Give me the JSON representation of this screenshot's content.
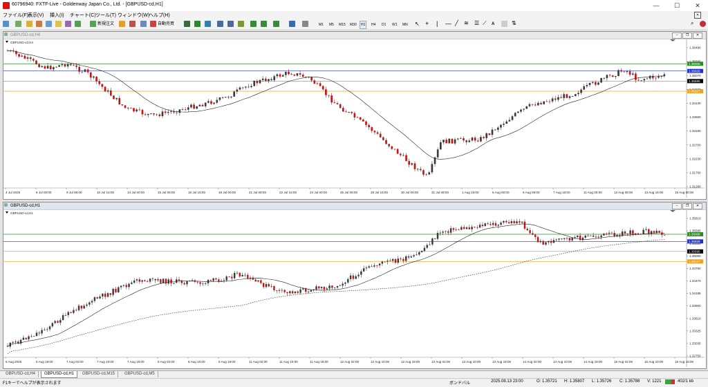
{
  "window": {
    "title": "60796940: FXTF-Live - Goldenway Japan Co., Ltd. - [GBPUSD-cd,H1]"
  },
  "menu": [
    "ファイル(F)",
    "表示(V)",
    "挿入(I)",
    "チャート(C)",
    "ツール(T)",
    "ウィンドウ(W)",
    "ヘルプ(H)"
  ],
  "toolbar": {
    "new_order": "新規注文",
    "auto_trade": "自動売買",
    "timeframes": [
      "M1",
      "M5",
      "M15",
      "M30",
      "H1",
      "H4",
      "D1",
      "W1",
      "MN"
    ],
    "active_timeframe": "H1",
    "letter_a": "A"
  },
  "chart_h4": {
    "window_title": "GBPUSD-cd,H4",
    "label": "GBPUSD-cd,H4",
    "price_ticks": [
      "1.36490",
      "1.35595",
      "1.35070",
      "1.34600",
      "1.34130",
      "1.33650",
      "1.33180",
      "1.32700",
      "1.32230",
      "1.31760",
      "1.31280"
    ],
    "price_tags": [
      {
        "text": "1.36006",
        "color": "#2e8b2e"
      },
      {
        "text": "1.35826",
        "color": "#2233cc"
      },
      {
        "text": "1.35595",
        "color": "#000000"
      },
      {
        "text": "1.35127",
        "color": "#f0a020"
      }
    ],
    "time_labels": [
      "4 Jul 2025",
      "8 Jul 00:00",
      "9 Jul 08:00",
      "10 Jul 16:00",
      "14 Jul 00:00",
      "15 Jul 08:00",
      "16 Jul 16:00",
      "18 Jul 00:00",
      "21 Jul 08:00",
      "22 Jul 16:00",
      "24 Jul 00:00",
      "25 Jul 08:00",
      "28 Jul 16:00",
      "30 Jul 00:00",
      "31 Jul 08:00",
      "1 Aug 16:00",
      "5 Aug 00:00",
      "6 Aug 08:00",
      "7 Aug 16:00",
      "11 Aug 00:00",
      "12 Aug 08:00",
      "13 Aug 16:00",
      "15 Aug 00:00"
    ]
  },
  "chart_h1": {
    "window_title": "GBPUSD-cd,H1",
    "label": "GBPUSD-cd,H1",
    "price_ticks": [
      "1.35810",
      "1.35595",
      "1.35325",
      "1.35050",
      "1.34760",
      "1.34470",
      "1.34185",
      "1.33900",
      "1.33610",
      "1.33325",
      "1.33035",
      "1.32750"
    ],
    "price_tags": [
      {
        "text": "1.36006",
        "color": "#2e8b2e"
      },
      {
        "text": "1.35826",
        "color": "#2233cc"
      },
      {
        "text": "1.35595",
        "color": "#000000"
      },
      {
        "text": "1.35127",
        "color": "#f0a020"
      }
    ],
    "time_labels": [
      "6 Aug 2025",
      "6 Aug 18:00",
      "7 Aug 02:00",
      "7 Aug 10:00",
      "7 Aug 18:00",
      "8 Aug 02:00",
      "8 Aug 10:00",
      "8 Aug 18:00",
      "11 Aug 02:00",
      "11 Aug 10:00",
      "11 Aug 18:00",
      "12 Aug 02:00",
      "12 Aug 10:00",
      "12 Aug 18:00",
      "13 Aug 02:00",
      "13 Aug 10:00",
      "13 Aug 18:00",
      "14 Aug 02:00",
      "14 Aug 10:00",
      "14 Aug 18:00",
      "15 Aug 02:00",
      "15 Aug 10:00",
      "15 Aug 18:00"
    ]
  },
  "tabs": [
    "GBPUSD-cd,H4",
    "GBPUSD-cd,H1",
    "GBPUSD-cd,M15",
    "GBPUSD-cd,M5"
  ],
  "active_tab": "GBPUSD-cd,H1",
  "status": {
    "help": "F1キーでヘルプが表示されます",
    "profile": "ボンドバル",
    "datetime": "2025.08.13 23:00",
    "open": "O: 1.35721",
    "high": "H: 1.35807",
    "low": "L: 1.35726",
    "close": "C: 1.35788",
    "volume": "V: 1221",
    "traffic": "402/1 kb"
  },
  "colors": {
    "green_line": "#2e8b2e",
    "blue_line": "#2233cc",
    "orange_line": "#f0a020",
    "bull": "#3a3a3a",
    "bear": "#cc1111"
  }
}
